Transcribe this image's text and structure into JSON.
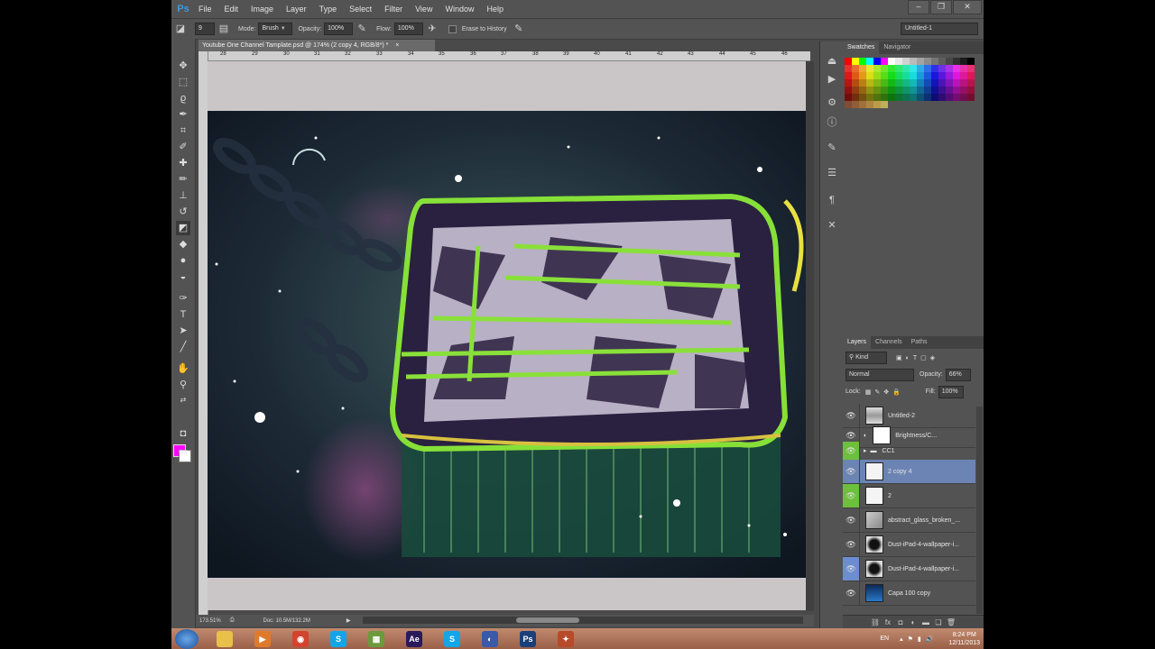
{
  "menu": {
    "logo": "Ps",
    "items": [
      "File",
      "Edit",
      "Image",
      "Layer",
      "Type",
      "Select",
      "Filter",
      "View",
      "Window",
      "Help"
    ]
  },
  "options": {
    "brush_size": "9",
    "mode_label": "Mode:",
    "mode_value": "Brush",
    "opacity_label": "Opacity:",
    "opacity_value": "100%",
    "flow_label": "Flow:",
    "flow_value": "100%",
    "erase_history_label": "Erase to History",
    "workspace": "Untitled-1"
  },
  "document": {
    "tab_title": "Youtube One Channel Tamplate.psd @ 174% (2 copy 4, RGB/8*) *",
    "ruler_ticks": [
      "28",
      "29",
      "30",
      "31",
      "32",
      "33",
      "34",
      "35",
      "36",
      "37",
      "38",
      "39",
      "40",
      "41",
      "42",
      "43",
      "44",
      "45",
      "46"
    ],
    "zoom": "173.51%",
    "doc_size": "Doc: 10.5M/132.2M"
  },
  "right_panel": {
    "top_tabs": [
      "Swatches",
      "Navigator"
    ],
    "layer_tabs": [
      "Layers",
      "Channels",
      "Paths"
    ],
    "kind_label": "Kind",
    "blend_mode": "Normal",
    "opacity_label": "Opacity:",
    "opacity_value": "66%",
    "lock_label": "Lock:",
    "fill_label": "Fill:",
    "fill_value": "100%",
    "layers": [
      {
        "name": "Untitled-2",
        "visible": true,
        "selected": false
      },
      {
        "name": "Brightness/C...",
        "visible": true,
        "selected": false
      },
      {
        "name": "CC1",
        "visible": true,
        "selected": false
      },
      {
        "name": "2 copy 4",
        "visible": true,
        "selected": true
      },
      {
        "name": "2",
        "visible": true,
        "selected": false
      },
      {
        "name": "abstract_glass_broken_...",
        "visible": true,
        "selected": false
      },
      {
        "name": "Dust-iPad-4-wallpaper-i...",
        "visible": true,
        "selected": false
      },
      {
        "name": "Dust-iPad-4-wallpaper-i...",
        "visible": true,
        "selected": false
      },
      {
        "name": "Capa 100 copy",
        "visible": true,
        "selected": false
      }
    ]
  },
  "taskbar": {
    "apps": [
      {
        "name": "explorer",
        "label": "",
        "color": "#e8c04a"
      },
      {
        "name": "media",
        "label": "▶",
        "color": "#e07a2a"
      },
      {
        "name": "chrome",
        "label": "◉",
        "color": "#d4432e"
      },
      {
        "name": "skype",
        "label": "S",
        "color": "#12a5e8"
      },
      {
        "name": "minecraft",
        "label": "▦",
        "color": "#6c9a3c"
      },
      {
        "name": "after-effects",
        "label": "Ae",
        "color": "#2a1a5a"
      },
      {
        "name": "skype2",
        "label": "S",
        "color": "#12a5e8"
      },
      {
        "name": "browser",
        "label": "◐",
        "color": "#3a5aa8"
      },
      {
        "name": "photoshop",
        "label": "Ps",
        "color": "#1b3f78"
      },
      {
        "name": "tool",
        "label": "✦",
        "color": "#b84a2a"
      }
    ],
    "lang": "EN",
    "time": "8:24 PM",
    "date": "12/11/2013"
  }
}
